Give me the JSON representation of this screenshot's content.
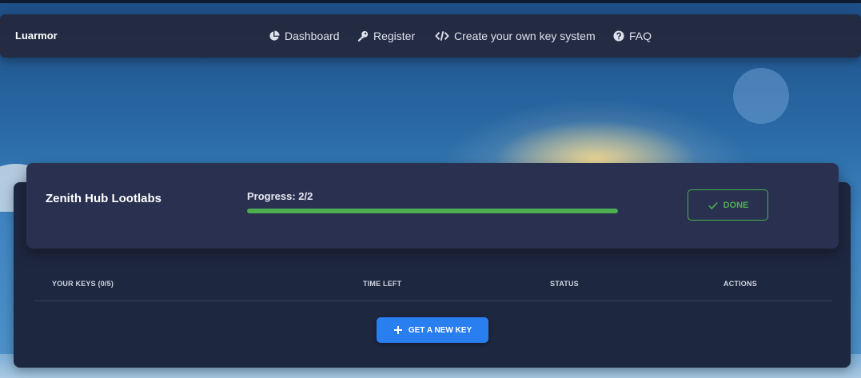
{
  "brand": "Luarmor",
  "nav": {
    "dashboard": "Dashboard",
    "register": "Register",
    "create": "Create your own key system",
    "faq": "FAQ"
  },
  "card": {
    "title": "Zenith Hub Lootlabs",
    "progress_label": "Progress: 2/2",
    "progress_value": 1.0,
    "done_label": "DONE"
  },
  "table": {
    "headers": [
      "YOUR KEYS (0/5)",
      "TIME LEFT",
      "STATUS",
      "ACTIONS"
    ]
  },
  "actions": {
    "get_key_label": "GET A NEW KEY"
  },
  "colors": {
    "accent_green": "#4cae4f",
    "accent_blue": "#2a7ff0"
  },
  "icons": [
    "pie-chart-icon",
    "key-icon",
    "code-icon",
    "question-circle-icon",
    "check-icon",
    "plus-icon"
  ]
}
